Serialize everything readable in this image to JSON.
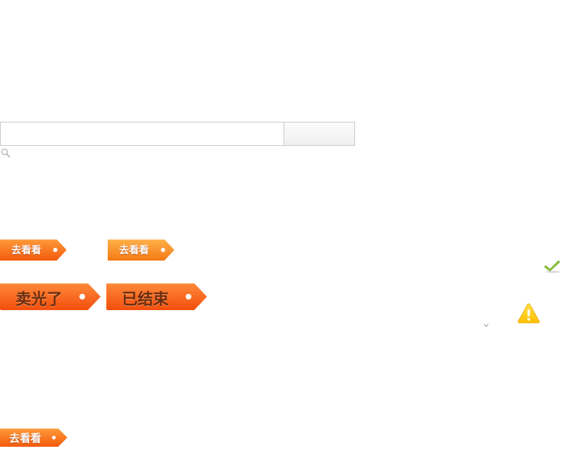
{
  "search": {
    "placeholder": "",
    "value": "",
    "button_label": ""
  },
  "tags": {
    "go_look_1": "去看看",
    "go_look_2": "去看看",
    "sold_out": "卖光了",
    "ended": "已结束",
    "go_look_3": "去看看"
  },
  "colors": {
    "tag_orange_top": "#ff9a3a",
    "tag_orange_bottom": "#f25a0c",
    "tag_light_top": "#ffb04a",
    "tag_light_bottom": "#f47a14",
    "check_green": "#8cc43c",
    "warning_yellow": "#ffcc00"
  },
  "icons": [
    "search-icon",
    "check-icon",
    "warning-icon",
    "chevron-down-icon"
  ]
}
